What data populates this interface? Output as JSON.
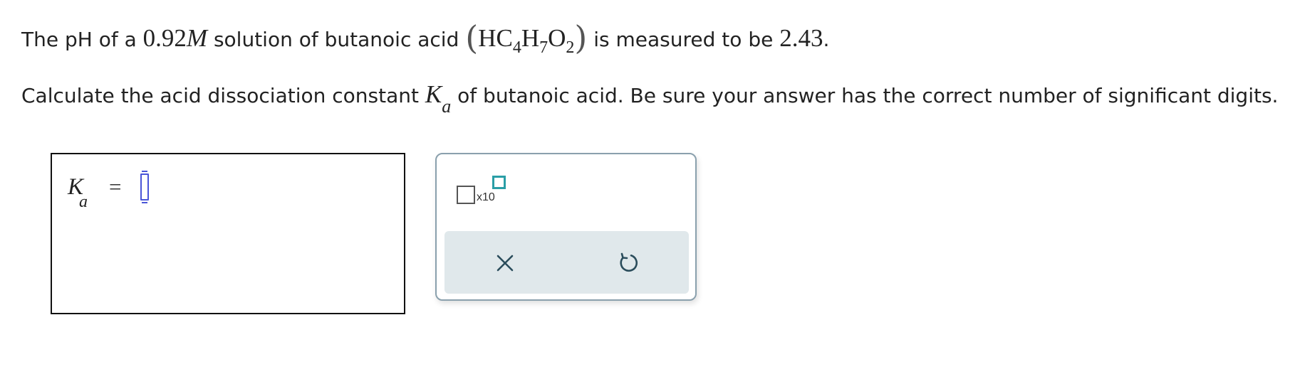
{
  "question": {
    "line1": {
      "t1": "The pH of a ",
      "concentration": "0.92",
      "unit": "M",
      "t2": " solution of butanoic acid ",
      "open_paren": "(",
      "f_HC": "HC",
      "f_4": "4",
      "f_H": "H",
      "f_7": "7",
      "f_O": "O",
      "f_2": "2",
      "close_paren": ")",
      "t3": " is measured to be ",
      "ph_value": "2.43",
      "t4": "."
    },
    "line2": {
      "t1": "Calculate the acid dissociation constant ",
      "k": "K",
      "k_sub": "a",
      "t2": " of butanoic acid. Be sure your answer has the correct number of significant digits."
    }
  },
  "answer": {
    "label_k": "K",
    "label_sub": "a",
    "equals": "=",
    "value": ""
  },
  "tools": {
    "sci_notation_label": "x10",
    "clear_icon": "close-icon",
    "undo_icon": "undo-icon",
    "accent_color": "#2a9ea6",
    "input_color": "#4a55d8"
  }
}
